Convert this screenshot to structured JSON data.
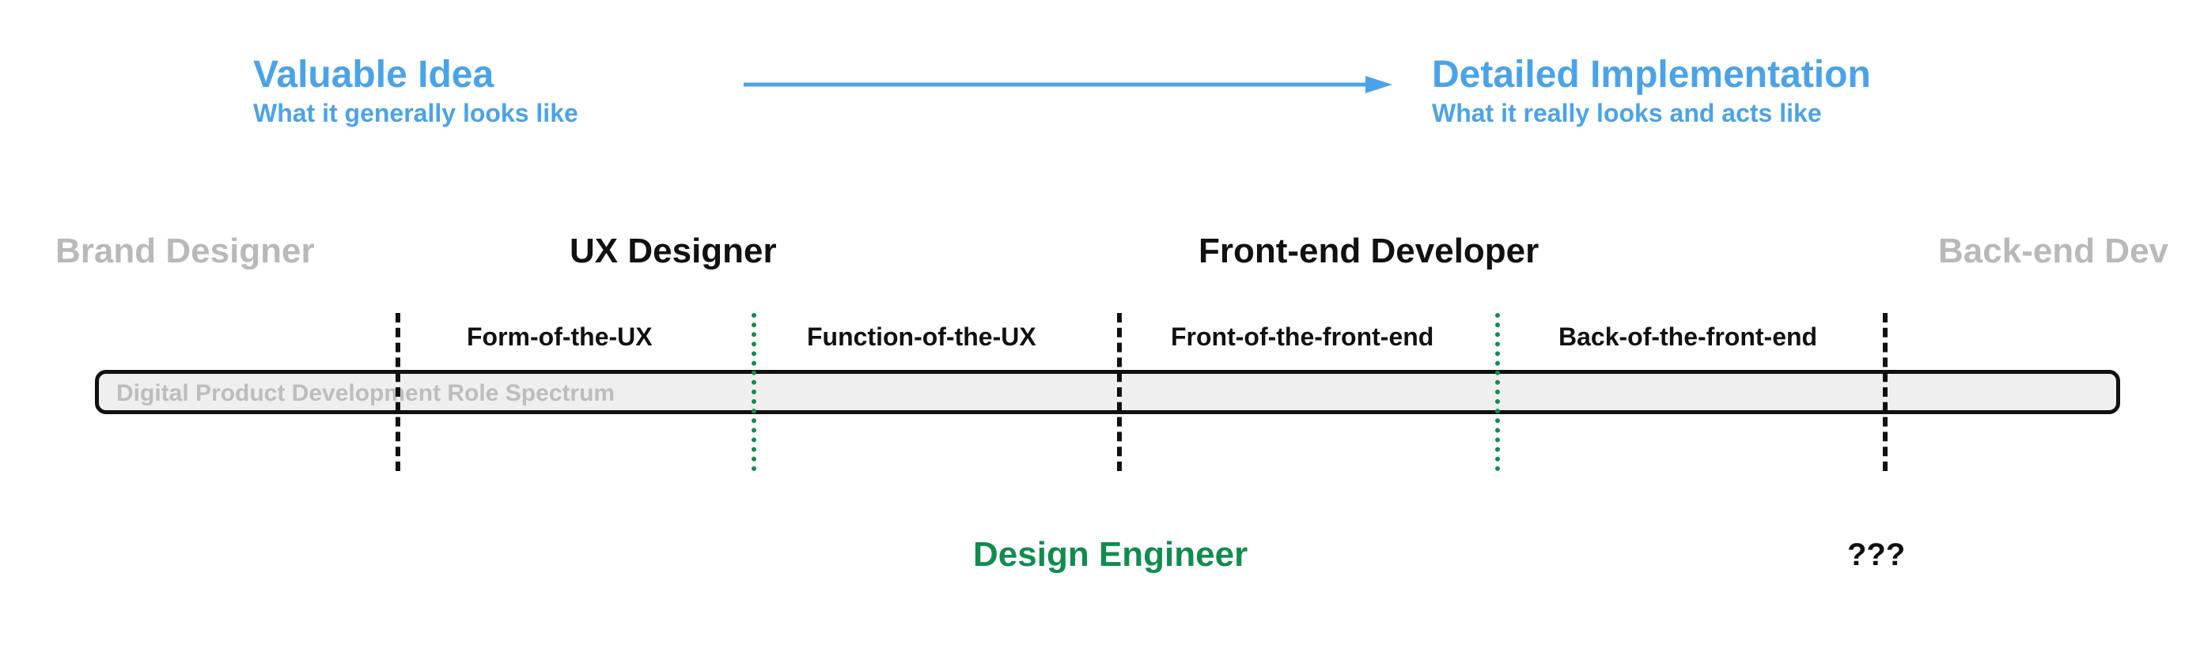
{
  "header": {
    "left_title": "Valuable Idea",
    "left_subtitle": "What it generally looks like",
    "right_title": "Detailed Implementation",
    "right_subtitle": "What it really looks and acts like"
  },
  "roles": {
    "brand_designer": "Brand Designer",
    "ux_designer": "UX Designer",
    "frontend_dev": "Front-end Developer",
    "backend_dev": "Back-end Dev"
  },
  "segments": {
    "form_of_ux": "Form-of-the-UX",
    "function_of_ux": "Function-of-the-UX",
    "front_of_front": "Front-of-the-front-end",
    "back_of_front": "Back-of-the-front-end"
  },
  "bar_caption": "Digital Product Development Role Spectrum",
  "design_engineer_label": "Design Engineer",
  "mystery_label": "???",
  "colors": {
    "blue": "#4aa3e8",
    "green": "#118c4f",
    "gray": "#b9b9b9",
    "black": "#111111",
    "bar_fill": "#efefef"
  },
  "chart_data": {
    "type": "table",
    "title": "Digital Product Development Role Spectrum",
    "axis": {
      "from": "Valuable Idea — What it generally looks like",
      "to": "Detailed Implementation — What it really looks and acts like"
    },
    "roles_order": [
      "Brand Designer",
      "UX Designer",
      "Front-end Developer",
      "Back-end Dev"
    ],
    "segments": [
      {
        "label": "Form-of-the-UX",
        "parent_role": "UX Designer"
      },
      {
        "label": "Function-of-the-UX",
        "parent_role": "UX Designer"
      },
      {
        "label": "Front-of-the-front-end",
        "parent_role": "Front-end Developer"
      },
      {
        "label": "Back-of-the-front-end",
        "parent_role": "Front-end Developer"
      }
    ],
    "design_engineer_span": [
      "Function-of-the-UX",
      "Front-of-the-front-end"
    ],
    "unknown_marker_after": "Back-of-the-front-end"
  }
}
